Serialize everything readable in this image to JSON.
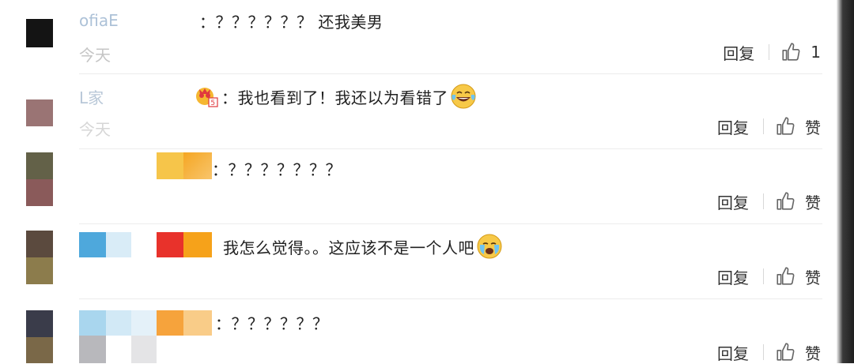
{
  "comments": [
    {
      "name_partial": "ofiaE",
      "time_partial": "今天",
      "text": "：？？？？？？ 还我美男",
      "reply_label": "回复",
      "like_label": "1"
    },
    {
      "name_partial": "L家",
      "time_partial": "今天",
      "text": "：我也看到了！我还以为看错了",
      "reply_label": "回复",
      "like_label": "赞"
    },
    {
      "text": "：？？？？？？？",
      "reply_label": "回复",
      "like_label": "赞"
    },
    {
      "text": "我怎么觉得。。这应该不是一个人吧",
      "reply_label": "回复",
      "like_label": "赞"
    },
    {
      "text": "：？？？？？？",
      "reply_label": "回复",
      "like_label": "赞"
    }
  ],
  "icons": {
    "like": "thumbs-up-icon",
    "laugh_cry": "laughing-tears-emoji-icon",
    "cry": "crying-emoji-icon",
    "badge": "vip-badge-icon"
  },
  "colors": {
    "text": "#222222",
    "secondary": "#c9d6e2",
    "divider": "#ececec",
    "emoji_yellow": "#f7c948"
  }
}
